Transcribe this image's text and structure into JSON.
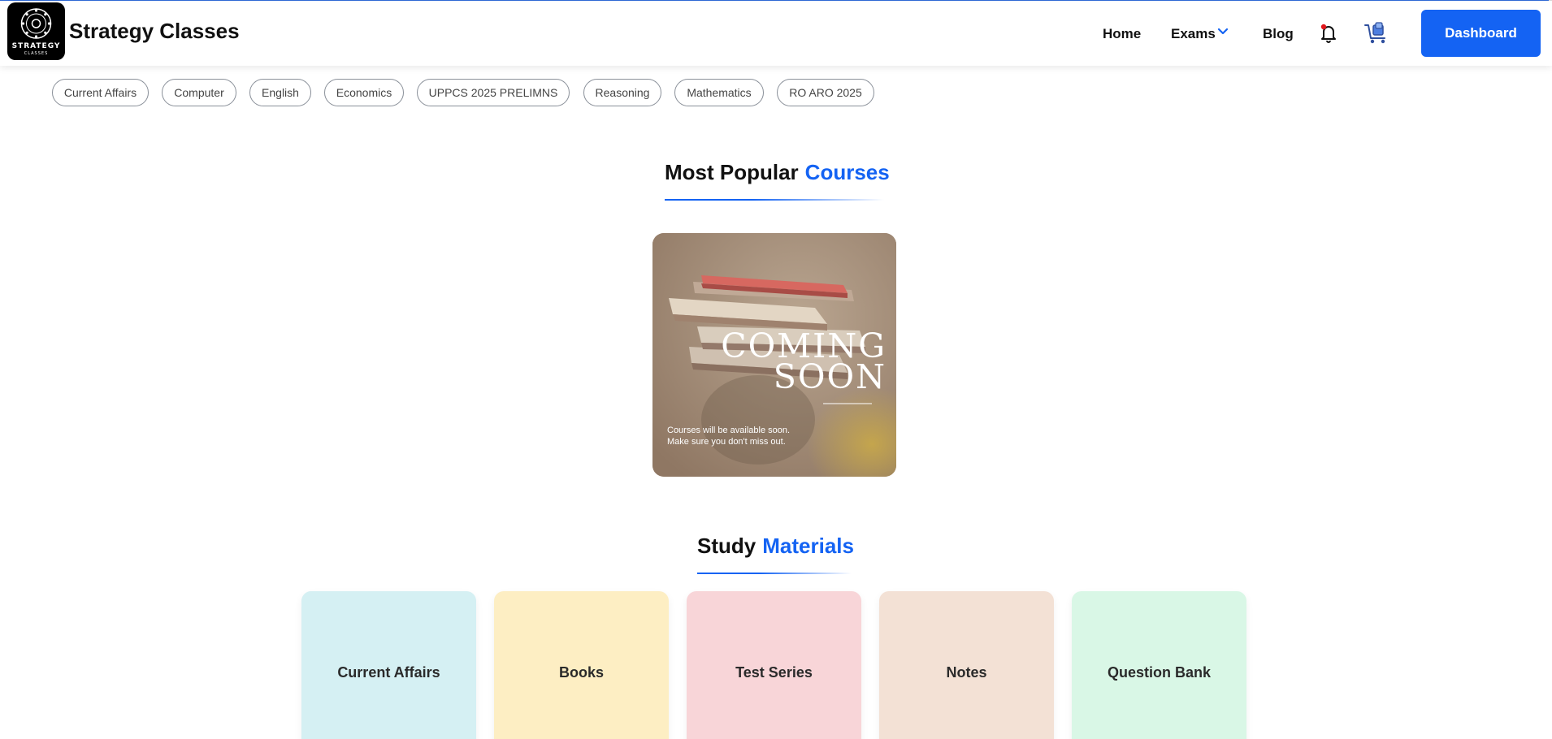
{
  "header": {
    "brand": "Strategy Classes",
    "logo_text": "STRATEGY",
    "logo_subtext": "CLASSES",
    "nav": {
      "home": "Home",
      "exams": "Exams",
      "blog": "Blog"
    },
    "dashboard_label": "Dashboard",
    "icons": [
      "bell-icon",
      "cart-icon",
      "chevron-down-icon"
    ]
  },
  "categories": [
    "Current Affairs",
    "Computer",
    "English",
    "Economics",
    "UPPCS 2025 PRELIMNS",
    "Reasoning",
    "Mathematics",
    "RO ARO 2025"
  ],
  "popular": {
    "title_main": "Most Popular",
    "title_accent": "Courses",
    "card": {
      "line1": "COMING",
      "line2": "SOON",
      "note1": "Courses will be available soon.",
      "note2": "Make sure you don't miss out."
    }
  },
  "study": {
    "title_main": "Study",
    "title_accent": "Materials",
    "items": [
      "Current Affairs",
      "Books",
      "Test Series",
      "Notes",
      "Question Bank"
    ]
  },
  "colors": {
    "accent": "#1463f3",
    "material_cards": [
      "#d5f0f3",
      "#fdeec3",
      "#f8d5d8",
      "#f3e1d5",
      "#d9f7e6"
    ]
  }
}
